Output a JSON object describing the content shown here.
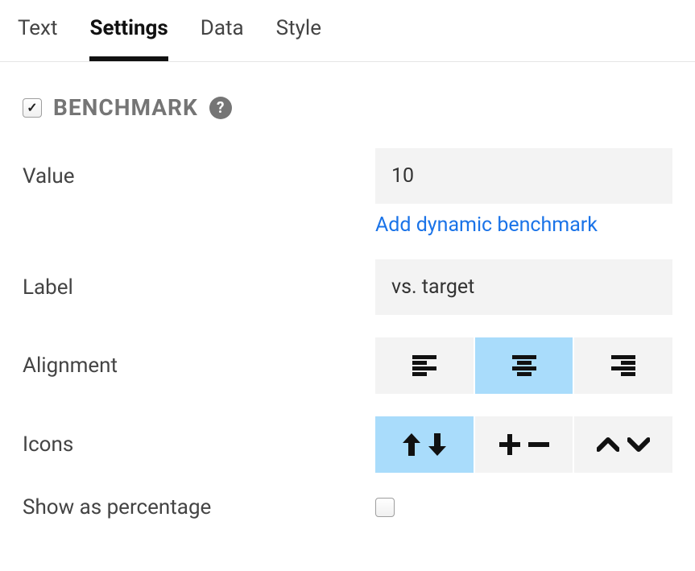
{
  "tabs": {
    "text": "Text",
    "settings": "Settings",
    "data": "Data",
    "style": "Style",
    "active": "settings"
  },
  "section": {
    "title": "BENCHMARK",
    "enabled": true
  },
  "fields": {
    "value_label": "Value",
    "value": "10",
    "dynamic_link": "Add dynamic benchmark",
    "label_label": "Label",
    "label_value": "vs. target",
    "alignment_label": "Alignment",
    "alignment_selected": "center",
    "icons_label": "Icons",
    "icons_selected": "arrows",
    "show_pct_label": "Show as percentage",
    "show_pct_checked": false
  }
}
